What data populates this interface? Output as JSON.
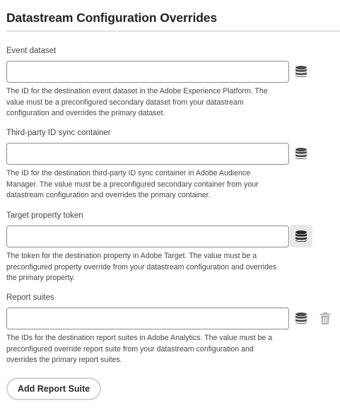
{
  "section": {
    "title": "Datastream Configuration Overrides"
  },
  "fields": [
    {
      "label": "Event dataset",
      "value": "",
      "help": "The ID for the destination event dataset in the Adobe Experience Platform. The value must be a preconfigured secondary dataset from your datastream configuration and overrides the primary dataset.",
      "icon": "data-element-icon"
    },
    {
      "label": "Third-party ID sync container",
      "value": "",
      "help": "The ID for the destination third-party ID sync container in Adobe Audience Manager. The value must be a preconfigured secondary container from your datastream configuration and overrides the primary container.",
      "icon": "data-element-icon"
    },
    {
      "label": "Target property token",
      "value": "",
      "help": "The token for the destination property in Adobe Target. The value must be a preconfigured property override from your datastream configuration and overrides the primary property.",
      "icon": "data-element-icon"
    },
    {
      "label": "Report suites",
      "value": "",
      "help": "The IDs for the destination report suites in Adobe Analytics. The value must be a preconfigured override report suite from your datastream configuration and overrides the primary report suites.",
      "icon": "data-element-icon",
      "secondary_icon": "trash-icon"
    }
  ],
  "actions": {
    "add_report_suite": "Add Report Suite"
  },
  "colors": {
    "text": "#2c2c2c",
    "icon": "#4b4b4b",
    "icon_disabled": "#b3b3b3",
    "input_border": "#8e8e8e",
    "active_icon_bg": "#e8e8e8"
  }
}
